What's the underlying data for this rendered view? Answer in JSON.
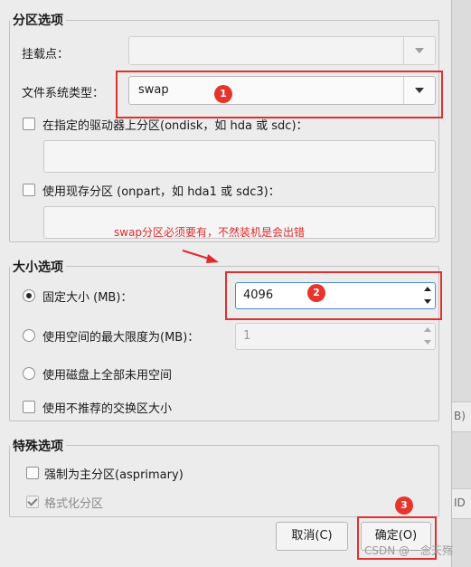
{
  "partition_options": {
    "title": "分区选项",
    "mount_point_label": "挂载点：",
    "mount_point_value": "",
    "fs_type_label": "文件系统类型：",
    "fs_type_value": "swap",
    "ondisk_label": "在指定的驱动器上分区(ondisk，如  hda 或  sdc)：",
    "ondisk_value": "",
    "onpart_label": "使用现存分区 (onpart，如  hda1 或  sdc3)：",
    "onpart_value": ""
  },
  "annotation_note": "swap分区必须要有，不然装机是会出错",
  "size_options": {
    "title": "大小选项",
    "fixed_label": "固定大小 (MB)：",
    "fixed_value": "4096",
    "max_label": "使用空间的最大限度为(MB)：",
    "max_value": "1",
    "all_unused_label": "使用磁盘上全部未用空间",
    "recommended_swap_label": "使用不推荐的交换区大小"
  },
  "special_options": {
    "title": "特殊选项",
    "primary_label": "强制为主分区(asprimary)",
    "format_label": "格式化分区"
  },
  "buttons": {
    "cancel": "取消(C)",
    "ok": "确定(O)"
  },
  "badges": [
    "1",
    "2",
    "3"
  ],
  "watermark": "CSDN @一念天殇",
  "background_fragments": [
    "B)",
    "ID"
  ],
  "colors": {
    "highlight": "#e03030",
    "focus": "#4a90d9"
  }
}
